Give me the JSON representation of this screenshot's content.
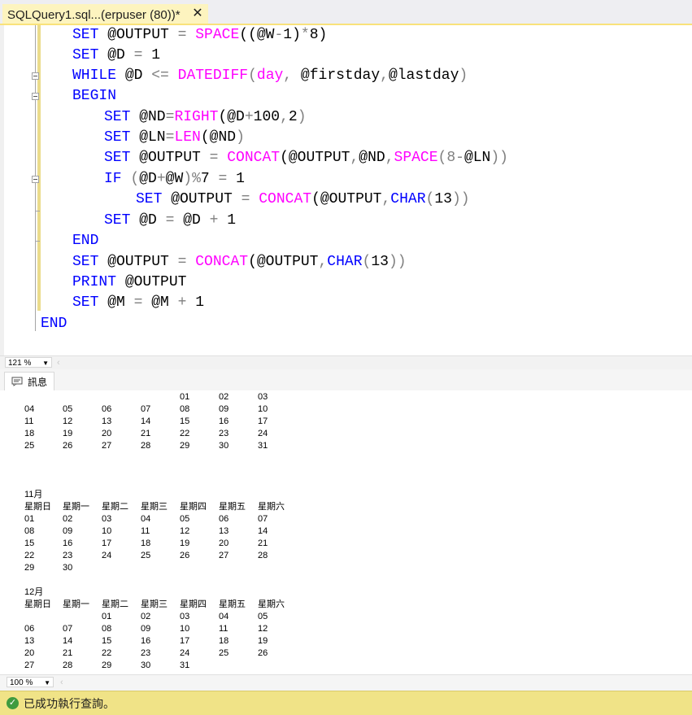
{
  "tab": {
    "title": "SQLQuery1.sql...(erpuser (80))*",
    "close": "✕"
  },
  "editor": {
    "lines": [
      [
        "SET",
        " @OUTPUT ",
        "=",
        " ",
        "SPACE",
        "((@W",
        "-",
        "1)",
        "*",
        "8)"
      ],
      [
        "SET",
        " @D ",
        "=",
        " 1"
      ],
      [
        "WHILE",
        " @D ",
        "<=",
        " ",
        "DATEDIFF",
        "(",
        "day",
        ",",
        " @firstday",
        ",",
        "@lastday",
        ")"
      ],
      [
        "BEGIN"
      ],
      [
        "SET",
        " @ND",
        "=",
        "RIGHT",
        "(@D",
        "+",
        "100",
        ",",
        "2",
        ")"
      ],
      [
        "SET",
        " @LN",
        "=",
        "LEN",
        "(@ND",
        ")"
      ],
      [
        "SET",
        " @OUTPUT ",
        "=",
        " ",
        "CONCAT",
        "(@OUTPUT",
        ",",
        "@ND",
        ",",
        "SPACE",
        "(8",
        "-",
        "@LN",
        "))"
      ],
      [
        "IF",
        " ",
        "(",
        "@D",
        "+",
        "@W",
        ")",
        "%",
        "7 ",
        "=",
        " 1"
      ],
      [
        "SET",
        " @OUTPUT ",
        "=",
        " ",
        "CONCAT",
        "(@OUTPUT",
        ",",
        "CHAR",
        "(",
        "13",
        "))"
      ],
      [
        "SET",
        " @D ",
        "=",
        " @D ",
        "+",
        " 1"
      ],
      [
        "END"
      ],
      [
        "SET",
        " @OUTPUT ",
        "=",
        " ",
        "CONCAT",
        "(@OUTPUT",
        ",",
        "CHAR",
        "(",
        "13",
        "))"
      ],
      [
        "PRINT",
        " @OUTPUT"
      ],
      [
        "SET",
        " @M ",
        "=",
        " @M ",
        "+",
        " 1"
      ],
      [
        "END"
      ]
    ]
  },
  "zoom_top": "121 %",
  "zoom_bottom": "100 %",
  "results_tab": "訊息",
  "messages": {
    "rows": [
      [
        "",
        "",
        "",
        "",
        "01",
        "02",
        "03"
      ],
      [
        "04",
        "05",
        "06",
        "07",
        "08",
        "09",
        "10"
      ],
      [
        "11",
        "12",
        "13",
        "14",
        "15",
        "16",
        "17"
      ],
      [
        "18",
        "19",
        "20",
        "21",
        "22",
        "23",
        "24"
      ],
      [
        "25",
        "26",
        "27",
        "28",
        "29",
        "30",
        "31"
      ],
      [],
      [],
      [],
      [
        "11月"
      ],
      [
        "星期日",
        "星期一",
        "星期二",
        "星期三",
        "星期四",
        "星期五",
        "星期六"
      ],
      [
        "01",
        "02",
        "03",
        "04",
        "05",
        "06",
        "07"
      ],
      [
        "08",
        "09",
        "10",
        "11",
        "12",
        "13",
        "14"
      ],
      [
        "15",
        "16",
        "17",
        "18",
        "19",
        "20",
        "21"
      ],
      [
        "22",
        "23",
        "24",
        "25",
        "26",
        "27",
        "28"
      ],
      [
        "29",
        "30"
      ],
      [],
      [
        "12月"
      ],
      [
        "星期日",
        "星期一",
        "星期二",
        "星期三",
        "星期四",
        "星期五",
        "星期六"
      ],
      [
        "",
        "",
        "01",
        "02",
        "03",
        "04",
        "05"
      ],
      [
        "06",
        "07",
        "08",
        "09",
        "10",
        "11",
        "12"
      ],
      [
        "13",
        "14",
        "15",
        "16",
        "17",
        "18",
        "19"
      ],
      [
        "20",
        "21",
        "22",
        "23",
        "24",
        "25",
        "26"
      ],
      [
        "27",
        "28",
        "29",
        "30",
        "31"
      ]
    ]
  },
  "status": {
    "text": "已成功執行查詢。",
    "icon": "check-icon"
  },
  "colors": {
    "keyword": "#0000ff",
    "function": "#ff00ff",
    "operator": "#808080",
    "tab": "#fdf4bf",
    "status": "#f0e387"
  }
}
